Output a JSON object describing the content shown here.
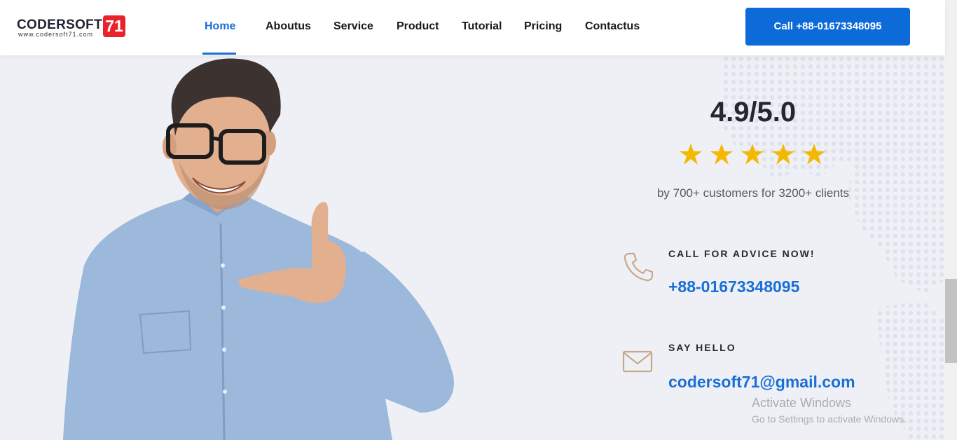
{
  "header": {
    "logo": {
      "name": "CODERSOFT",
      "number": "71",
      "url": "www.codersoft71.com"
    },
    "nav": [
      {
        "label": "Home",
        "active": true
      },
      {
        "label": "Aboutus",
        "active": false
      },
      {
        "label": "Service",
        "active": false
      },
      {
        "label": "Product",
        "active": false
      },
      {
        "label": "Tutorial",
        "active": false
      },
      {
        "label": "Pricing",
        "active": false
      },
      {
        "label": "Contactus",
        "active": false
      }
    ],
    "cta_label": "Call +88-01673348095"
  },
  "rating": {
    "score": "4.9/5.0",
    "stars": 5,
    "star_color": "#f5b800",
    "subtitle": "by 700+ customers for 3200+ clients"
  },
  "contact": {
    "call": {
      "label": "CALL FOR ADVICE NOW!",
      "value": "+88-01673348095",
      "icon": "phone-icon"
    },
    "email": {
      "label": "SAY HELLO",
      "value": "codersoft71@gmail.com",
      "icon": "mail-icon"
    }
  },
  "watermark": {
    "title": "Activate Windows",
    "subtitle": "Go to Settings to activate Windows."
  },
  "colors": {
    "accent": "#1a6fd6",
    "cta_background": "#0d6ad9",
    "logo_badge": "#e8232b",
    "page_background": "#eef0f6",
    "contact_icon": "#c9a88a"
  }
}
